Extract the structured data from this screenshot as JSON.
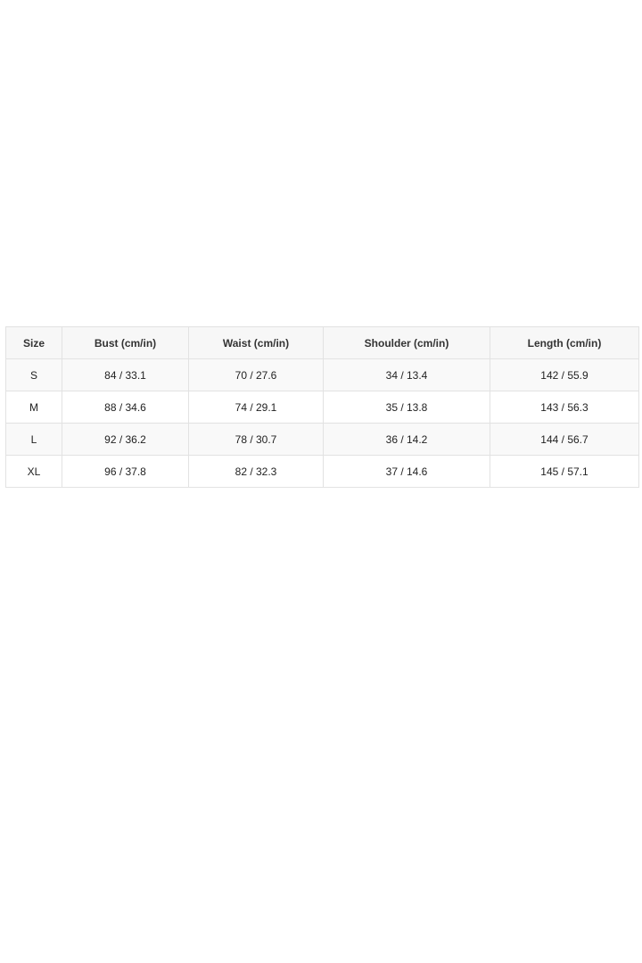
{
  "size_chart": {
    "headers": [
      "Size",
      "Bust (cm/in)",
      "Waist (cm/in)",
      "Shoulder (cm/in)",
      "Length (cm/in)"
    ],
    "rows": [
      [
        "S",
        "84 / 33.1",
        "70 / 27.6",
        "34 / 13.4",
        "142 / 55.9"
      ],
      [
        "M",
        "88 / 34.6",
        "74 / 29.1",
        "35 / 13.8",
        "143 / 56.3"
      ],
      [
        "L",
        "92 / 36.2",
        "78 / 30.7",
        "36 / 14.2",
        "144 / 56.7"
      ],
      [
        "XL",
        "96 / 37.8",
        "82 / 32.3",
        "37 / 14.6",
        "145 / 57.1"
      ]
    ]
  }
}
